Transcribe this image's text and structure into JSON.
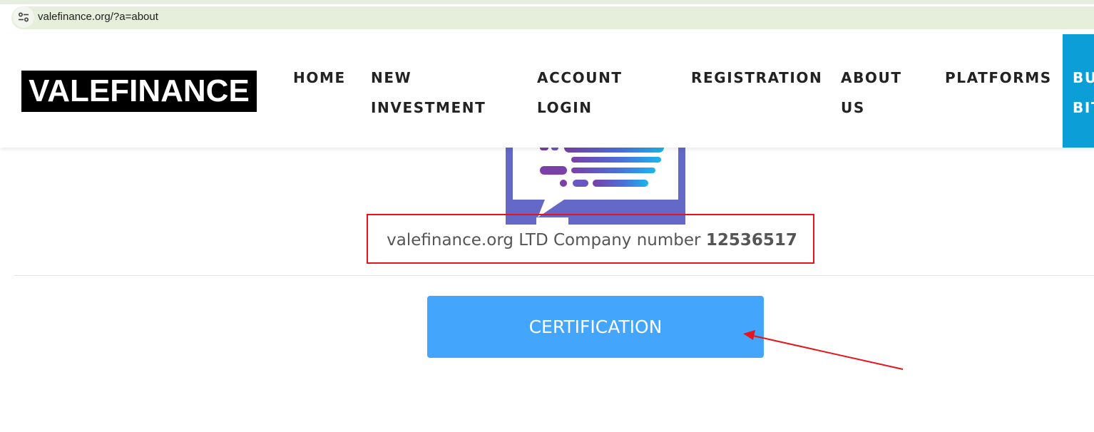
{
  "browser": {
    "url": "valefinance.org/?a=about",
    "site_info_icon": "tune-icon"
  },
  "header": {
    "logo_text": "VALEFINANCE",
    "nav": [
      {
        "lines": [
          "HOME"
        ]
      },
      {
        "lines": [
          "NEW",
          "INVESTMENT"
        ]
      },
      {
        "lines": [
          "ACCOUNT",
          "LOGIN"
        ]
      },
      {
        "lines": [
          "REGISTRATION"
        ]
      },
      {
        "lines": [
          "ABOUT",
          "US"
        ]
      },
      {
        "lines": [
          "PLATFORMS"
        ]
      }
    ],
    "cta": {
      "lines": [
        "BU",
        "BIT"
      ],
      "color": "#0c9ed6"
    }
  },
  "company": {
    "text": "valefinance.org LTD Company number ",
    "number": "12536517"
  },
  "certification_button": {
    "label": "CERTIFICATION",
    "color": "#43a5fc"
  },
  "annotation_color": "#e8141c"
}
